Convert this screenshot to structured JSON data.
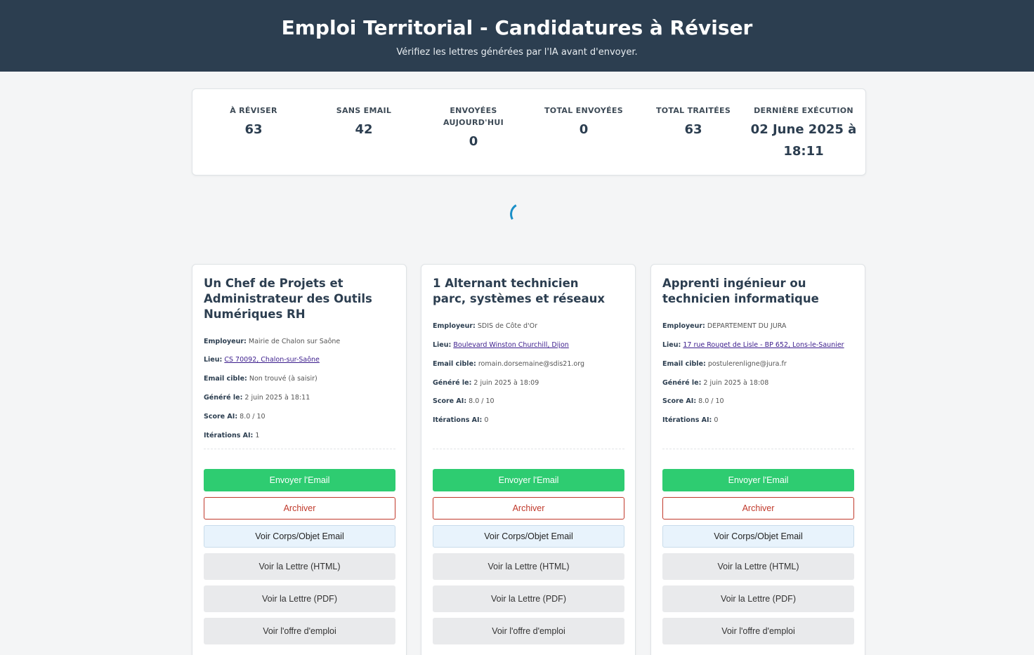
{
  "header": {
    "title": "Emploi Territorial - Candidatures à Réviser",
    "subtitle": "Vérifiez les lettres générées par l'IA avant d'envoyer."
  },
  "stats": [
    {
      "label": "À RÉVISER",
      "value": "63"
    },
    {
      "label": "SANS EMAIL",
      "value": "42"
    },
    {
      "label": "ENVOYÉES AUJOURD'HUI",
      "value": "0"
    },
    {
      "label": "TOTAL ENVOYÉES",
      "value": "0"
    },
    {
      "label": "TOTAL TRAITÉES",
      "value": "63"
    },
    {
      "label": "DERNIÈRE EXÉCUTION",
      "value": "02 June 2025 à 18:11"
    }
  ],
  "field_labels": {
    "employer": "Employeur:",
    "location": "Lieu:",
    "email": "Email cible:",
    "generated": "Généré le:",
    "score": "Score AI:",
    "iterations": "Itérations AI:"
  },
  "buttons": {
    "send": "Envoyer l'Email",
    "archive": "Archiver",
    "view_body": "Voir Corps/Objet Email",
    "view_html": "Voir la Lettre (HTML)",
    "view_pdf": "Voir la Lettre (PDF)",
    "view_offer": "Voir l'offre d'emploi"
  },
  "cards": [
    {
      "title": "Un Chef de Projets et Administrateur des Outils Numériques RH",
      "employer": "Mairie de Chalon sur Saône",
      "location": "CS 70092, Chalon-sur-Saône",
      "email": "Non trouvé (à saisir)",
      "generated": "2 juin 2025 à 18:11",
      "score": "8.0 / 10",
      "iterations": "1"
    },
    {
      "title": "1 Alternant technicien parc, systèmes et réseaux",
      "employer": "SDIS de Côte d'Or",
      "location": "Boulevard Winston Churchill, Dijon",
      "email": "romain.dorsemaine@sdis21.org",
      "generated": "2 juin 2025 à 18:09",
      "score": "8.0 / 10",
      "iterations": "0"
    },
    {
      "title": "Apprenti ingénieur ou technicien informatique",
      "employer": "DEPARTEMENT DU JURA",
      "location": "17 rue Rouget de Lisle - BP 652, Lons-le-Saunier",
      "email": "postulerenligne@jura.fr",
      "generated": "2 juin 2025 à 18:08",
      "score": "8.0 / 10",
      "iterations": "0"
    }
  ]
}
